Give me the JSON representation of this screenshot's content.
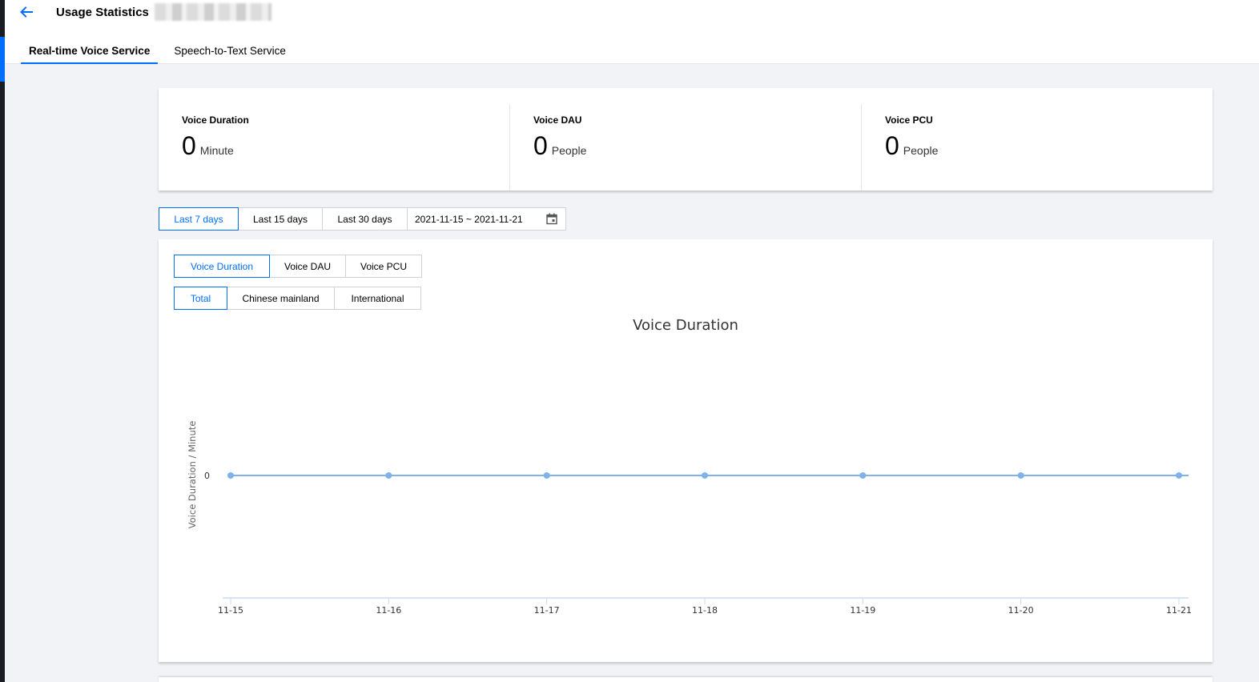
{
  "header": {
    "title": "Usage Statistics"
  },
  "tabs": [
    {
      "label": "Real-time Voice Service",
      "active": true
    },
    {
      "label": "Speech-to-Text Service",
      "active": false
    }
  ],
  "stats": [
    {
      "label": "Voice Duration",
      "value": "0",
      "unit": "Minute"
    },
    {
      "label": "Voice DAU",
      "value": "0",
      "unit": "People"
    },
    {
      "label": "Voice PCU",
      "value": "0",
      "unit": "People"
    }
  ],
  "range": {
    "options": [
      "Last 7 days",
      "Last 15 days",
      "Last 30 days"
    ],
    "selected": "Last 7 days",
    "date_range": "2021-11-15 ~ 2021-11-21"
  },
  "metric_tabs": {
    "options": [
      "Voice Duration",
      "Voice DAU",
      "Voice PCU"
    ],
    "selected": "Voice Duration"
  },
  "region_tabs": {
    "options": [
      "Total",
      "Chinese mainland",
      "International"
    ],
    "selected": "Total"
  },
  "colors": {
    "accent": "#006eff",
    "series": "#7fb3e8"
  },
  "icons": [
    "arrow-left-icon",
    "calendar-icon"
  ],
  "chart_data": {
    "type": "line",
    "title": "Voice Duration",
    "xlabel": "",
    "ylabel": "Voice Duration / Minute",
    "categories": [
      "11-15",
      "11-16",
      "11-17",
      "11-18",
      "11-19",
      "11-20",
      "11-21"
    ],
    "series": [
      {
        "values": [
          0,
          0,
          0,
          0,
          0,
          0,
          0
        ]
      }
    ],
    "yticks": [
      "0"
    ],
    "grid": false,
    "legend": "none"
  }
}
